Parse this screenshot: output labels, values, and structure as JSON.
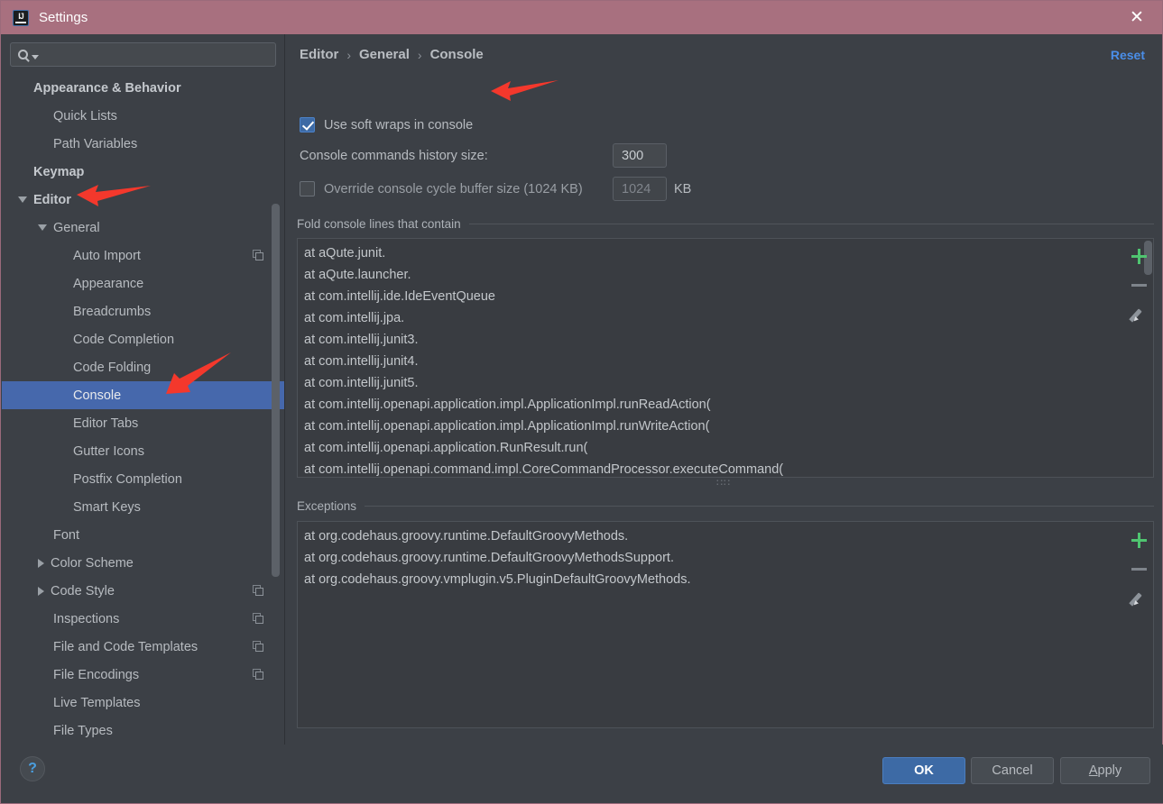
{
  "window": {
    "title": "Settings",
    "app_icon": "intellij-idea-icon",
    "close_icon": "close-icon",
    "titlebar_color": "#a8707f"
  },
  "sidebar": {
    "search": {
      "placeholder": "",
      "value": "",
      "icon": "search-icon",
      "caret_icon": "chevron-down-icon"
    },
    "items": [
      {
        "label": "Appearance & Behavior",
        "indent": 0,
        "arrow": "none",
        "bold": true,
        "selected": false,
        "copy": false
      },
      {
        "label": "Quick Lists",
        "indent": 1,
        "arrow": "none",
        "bold": false,
        "selected": false,
        "copy": false
      },
      {
        "label": "Path Variables",
        "indent": 1,
        "arrow": "none",
        "bold": false,
        "selected": false,
        "copy": false
      },
      {
        "label": "Keymap",
        "indent": 0,
        "arrow": "none",
        "bold": true,
        "selected": false,
        "copy": false
      },
      {
        "label": "Editor",
        "indent": 0,
        "arrow": "down",
        "bold": true,
        "selected": false,
        "copy": false
      },
      {
        "label": "General",
        "indent": 1,
        "arrow": "down",
        "bold": false,
        "selected": false,
        "copy": false
      },
      {
        "label": "Auto Import",
        "indent": 2,
        "arrow": "none",
        "bold": false,
        "selected": false,
        "copy": true
      },
      {
        "label": "Appearance",
        "indent": 2,
        "arrow": "none",
        "bold": false,
        "selected": false,
        "copy": false
      },
      {
        "label": "Breadcrumbs",
        "indent": 2,
        "arrow": "none",
        "bold": false,
        "selected": false,
        "copy": false
      },
      {
        "label": "Code Completion",
        "indent": 2,
        "arrow": "none",
        "bold": false,
        "selected": false,
        "copy": false
      },
      {
        "label": "Code Folding",
        "indent": 2,
        "arrow": "none",
        "bold": false,
        "selected": false,
        "copy": false
      },
      {
        "label": "Console",
        "indent": 2,
        "arrow": "none",
        "bold": false,
        "selected": true,
        "copy": false
      },
      {
        "label": "Editor Tabs",
        "indent": 2,
        "arrow": "none",
        "bold": false,
        "selected": false,
        "copy": false
      },
      {
        "label": "Gutter Icons",
        "indent": 2,
        "arrow": "none",
        "bold": false,
        "selected": false,
        "copy": false
      },
      {
        "label": "Postfix Completion",
        "indent": 2,
        "arrow": "none",
        "bold": false,
        "selected": false,
        "copy": false
      },
      {
        "label": "Smart Keys",
        "indent": 2,
        "arrow": "none",
        "bold": false,
        "selected": false,
        "copy": false
      },
      {
        "label": "Font",
        "indent": 1,
        "arrow": "none",
        "bold": false,
        "selected": false,
        "copy": false
      },
      {
        "label": "Color Scheme",
        "indent": 1,
        "arrow": "right",
        "bold": false,
        "selected": false,
        "copy": false
      },
      {
        "label": "Code Style",
        "indent": 1,
        "arrow": "right",
        "bold": false,
        "selected": false,
        "copy": true
      },
      {
        "label": "Inspections",
        "indent": 1,
        "arrow": "none",
        "bold": false,
        "selected": false,
        "copy": true
      },
      {
        "label": "File and Code Templates",
        "indent": 1,
        "arrow": "none",
        "bold": false,
        "selected": false,
        "copy": true
      },
      {
        "label": "File Encodings",
        "indent": 1,
        "arrow": "none",
        "bold": false,
        "selected": false,
        "copy": true
      },
      {
        "label": "Live Templates",
        "indent": 1,
        "arrow": "none",
        "bold": false,
        "selected": false,
        "copy": false
      },
      {
        "label": "File Types",
        "indent": 1,
        "arrow": "none",
        "bold": false,
        "selected": false,
        "copy": false
      }
    ],
    "selection_color": "#4668ac"
  },
  "main": {
    "breadcrumb": [
      "Editor",
      "General",
      "Console"
    ],
    "breadcrumb_separator": "›",
    "reset_label": "Reset",
    "soft_wraps": {
      "label": "Use soft wraps in console",
      "checked": true
    },
    "history": {
      "label": "Console commands history size:",
      "value": "300"
    },
    "override_buffer": {
      "label": "Override console cycle buffer size (1024 KB)",
      "checked": false,
      "value": "1024",
      "unit": "KB"
    },
    "fold_group": {
      "title": "Fold console lines that contain",
      "lines": [
        "at aQute.junit.",
        "at aQute.launcher.",
        "at com.intellij.ide.IdeEventQueue",
        "at com.intellij.jpa.",
        "at com.intellij.junit3.",
        "at com.intellij.junit4.",
        "at com.intellij.junit5.",
        "at com.intellij.openapi.application.impl.ApplicationImpl.runReadAction(",
        "at com.intellij.openapi.application.impl.ApplicationImpl.runWriteAction(",
        "at com.intellij.openapi.application.RunResult.run(",
        "at com.intellij.openapi.command.impl.CoreCommandProcessor.executeCommand("
      ]
    },
    "exceptions_group": {
      "title": "Exceptions",
      "lines": [
        "at org.codehaus.groovy.runtime.DefaultGroovyMethods.",
        "at org.codehaus.groovy.runtime.DefaultGroovyMethodsSupport.",
        "at org.codehaus.groovy.vmplugin.v5.PluginDefaultGroovyMethods."
      ]
    },
    "tools": [
      {
        "name": "add-button",
        "icon": "plus-icon",
        "color": "#4fc470"
      },
      {
        "name": "remove-button",
        "icon": "minus-icon",
        "color": "#7e848b"
      },
      {
        "name": "edit-button",
        "icon": "pencil-icon",
        "color": "#8d939a"
      }
    ],
    "splitter_grip": "∷∷"
  },
  "footer": {
    "help_label": "?",
    "ok_label": "OK",
    "cancel_label": "Cancel",
    "apply_mnemonic": "A",
    "apply_rest": "pply"
  },
  "annotations": {
    "color": "#f4382c",
    "arrows": [
      "arrow-to-soft-wraps-checkbox",
      "arrow-to-editor-node",
      "arrow-to-console-node"
    ]
  }
}
